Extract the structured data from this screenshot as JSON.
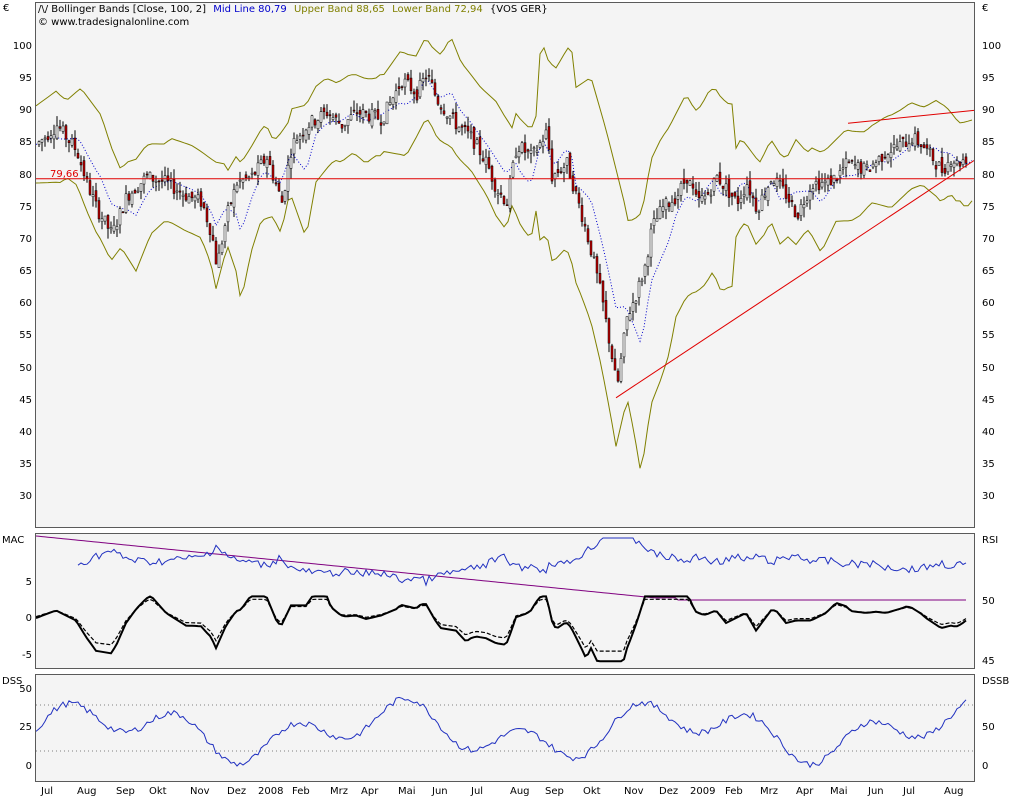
{
  "price_pane": {
    "currency_left": "€",
    "currency_right": "€",
    "indicator_label": "Bollinger Bands [Close, 100, 2]",
    "mid_line": "Mid Line 80,79",
    "upper_band": "Upper Band 88,65",
    "lower_band": "Lower Band 72,94",
    "symbol": "{VOS GER}",
    "watermark": "© www.tradesignalonline.com",
    "support_level_label": "79,66",
    "y_ticks": [
      "100",
      "95",
      "90",
      "85",
      "80",
      "75",
      "70",
      "65",
      "60",
      "55",
      "50",
      "45",
      "40",
      "35",
      "30"
    ],
    "colors": {
      "up_candle": "#ffffff",
      "down_candle": "#c00000",
      "mid_line": "#0000cc",
      "bands": "#808000",
      "trendline": "#e00000"
    }
  },
  "macd_pane": {
    "label_left": "MAC",
    "label_right": "RSI",
    "left_ticks": [
      "5",
      "0",
      "-5"
    ],
    "right_ticks": [
      "50",
      "45"
    ],
    "colors": {
      "rsi": "#2030c0",
      "rsi_avg": "#800080",
      "macd": "#000000"
    }
  },
  "dss_pane": {
    "label_left": "DSS",
    "label_right": "DSSB",
    "left_ticks": [
      "50",
      "25",
      "0"
    ],
    "right_ticks": [
      "50",
      "0"
    ],
    "colors": {
      "dss": "#2030c0",
      "ref_lines": "#808080"
    }
  },
  "x_axis": {
    "months": [
      "Jul",
      "Aug",
      "Sep",
      "Okt",
      "Nov",
      "Dez",
      "2008",
      "Feb",
      "Mrz",
      "Apr",
      "Mai",
      "Jun",
      "Jul",
      "Aug",
      "Sep",
      "Okt",
      "Nov",
      "Dez",
      "2009",
      "Feb",
      "Mrz",
      "Apr",
      "Mai",
      "Jun",
      "Jul",
      "Aug"
    ]
  }
}
